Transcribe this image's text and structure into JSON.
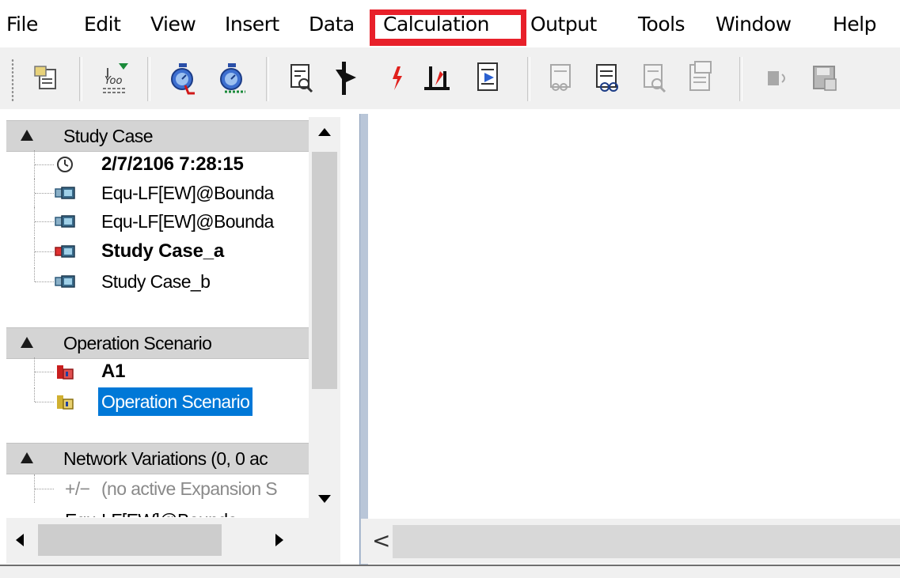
{
  "menubar": {
    "items": [
      "File",
      "Edit",
      "View",
      "Insert",
      "Data",
      "Calculation",
      "Output",
      "Tools",
      "Window",
      "Help"
    ],
    "highlighted_item": "Calculation",
    "highlight_color": "#e8202a"
  },
  "toolbar": {
    "buttons": [
      {
        "icon": "network-data-icon",
        "enabled": true
      },
      {
        "icon": "load-flow-settings-icon",
        "enabled": true
      },
      {
        "icon": "calculate-load-flow-icon",
        "enabled": true
      },
      {
        "icon": "calculate-short-circuit-icon",
        "enabled": true
      },
      {
        "icon": "edit-results-icon",
        "enabled": true
      },
      {
        "icon": "rms-simulation-icon",
        "enabled": true
      },
      {
        "icon": "fault-icon",
        "enabled": true
      },
      {
        "icon": "harmonics-icon",
        "enabled": true
      },
      {
        "icon": "output-report-icon",
        "enabled": true
      },
      {
        "icon": "results-view-icon",
        "enabled": false
      },
      {
        "icon": "variables-icon",
        "enabled": true
      },
      {
        "icon": "report-preview-icon",
        "enabled": false
      },
      {
        "icon": "document-report-icon",
        "enabled": false
      },
      {
        "icon": "reset-icon",
        "enabled": false
      },
      {
        "icon": "save-icon",
        "enabled": false
      }
    ]
  },
  "tree": {
    "study_case": {
      "header": "Study Case",
      "items": [
        {
          "label": "2/7/2106 7:28:15",
          "icon": "clock-icon",
          "bold": true
        },
        {
          "label": "Equ-LF[EW]@Bounda",
          "icon": "study-case-icon",
          "bold": false
        },
        {
          "label": "Equ-LF[EW]@Bounda",
          "icon": "study-case-icon",
          "bold": false
        },
        {
          "label": "Study Case_a",
          "icon": "active-study-case-icon",
          "bold": true
        },
        {
          "label": "Study Case_b",
          "icon": "study-case-icon",
          "bold": false
        }
      ]
    },
    "operation_scenario": {
      "header": "Operation Scenario",
      "items": [
        {
          "label": "A1",
          "icon": "active-scenario-icon",
          "bold": true
        },
        {
          "label": "Operation Scenario",
          "icon": "scenario-icon",
          "bold": false,
          "selected": true
        }
      ]
    },
    "network_variations": {
      "header": "Network Variations (0, 0 ac",
      "items": [
        {
          "prefix": "+/−",
          "label": "(no active Expansion S",
          "gray": true
        },
        {
          "label": "Equ-LF[EW]@Bounda",
          "partially_visible": true
        }
      ]
    }
  },
  "workspace": {
    "scroll_left_glyph": "<"
  },
  "colors": {
    "selection": "#0078d7",
    "section_header": "#d4d4d4",
    "toolbar_bg": "#f0f0f0"
  }
}
